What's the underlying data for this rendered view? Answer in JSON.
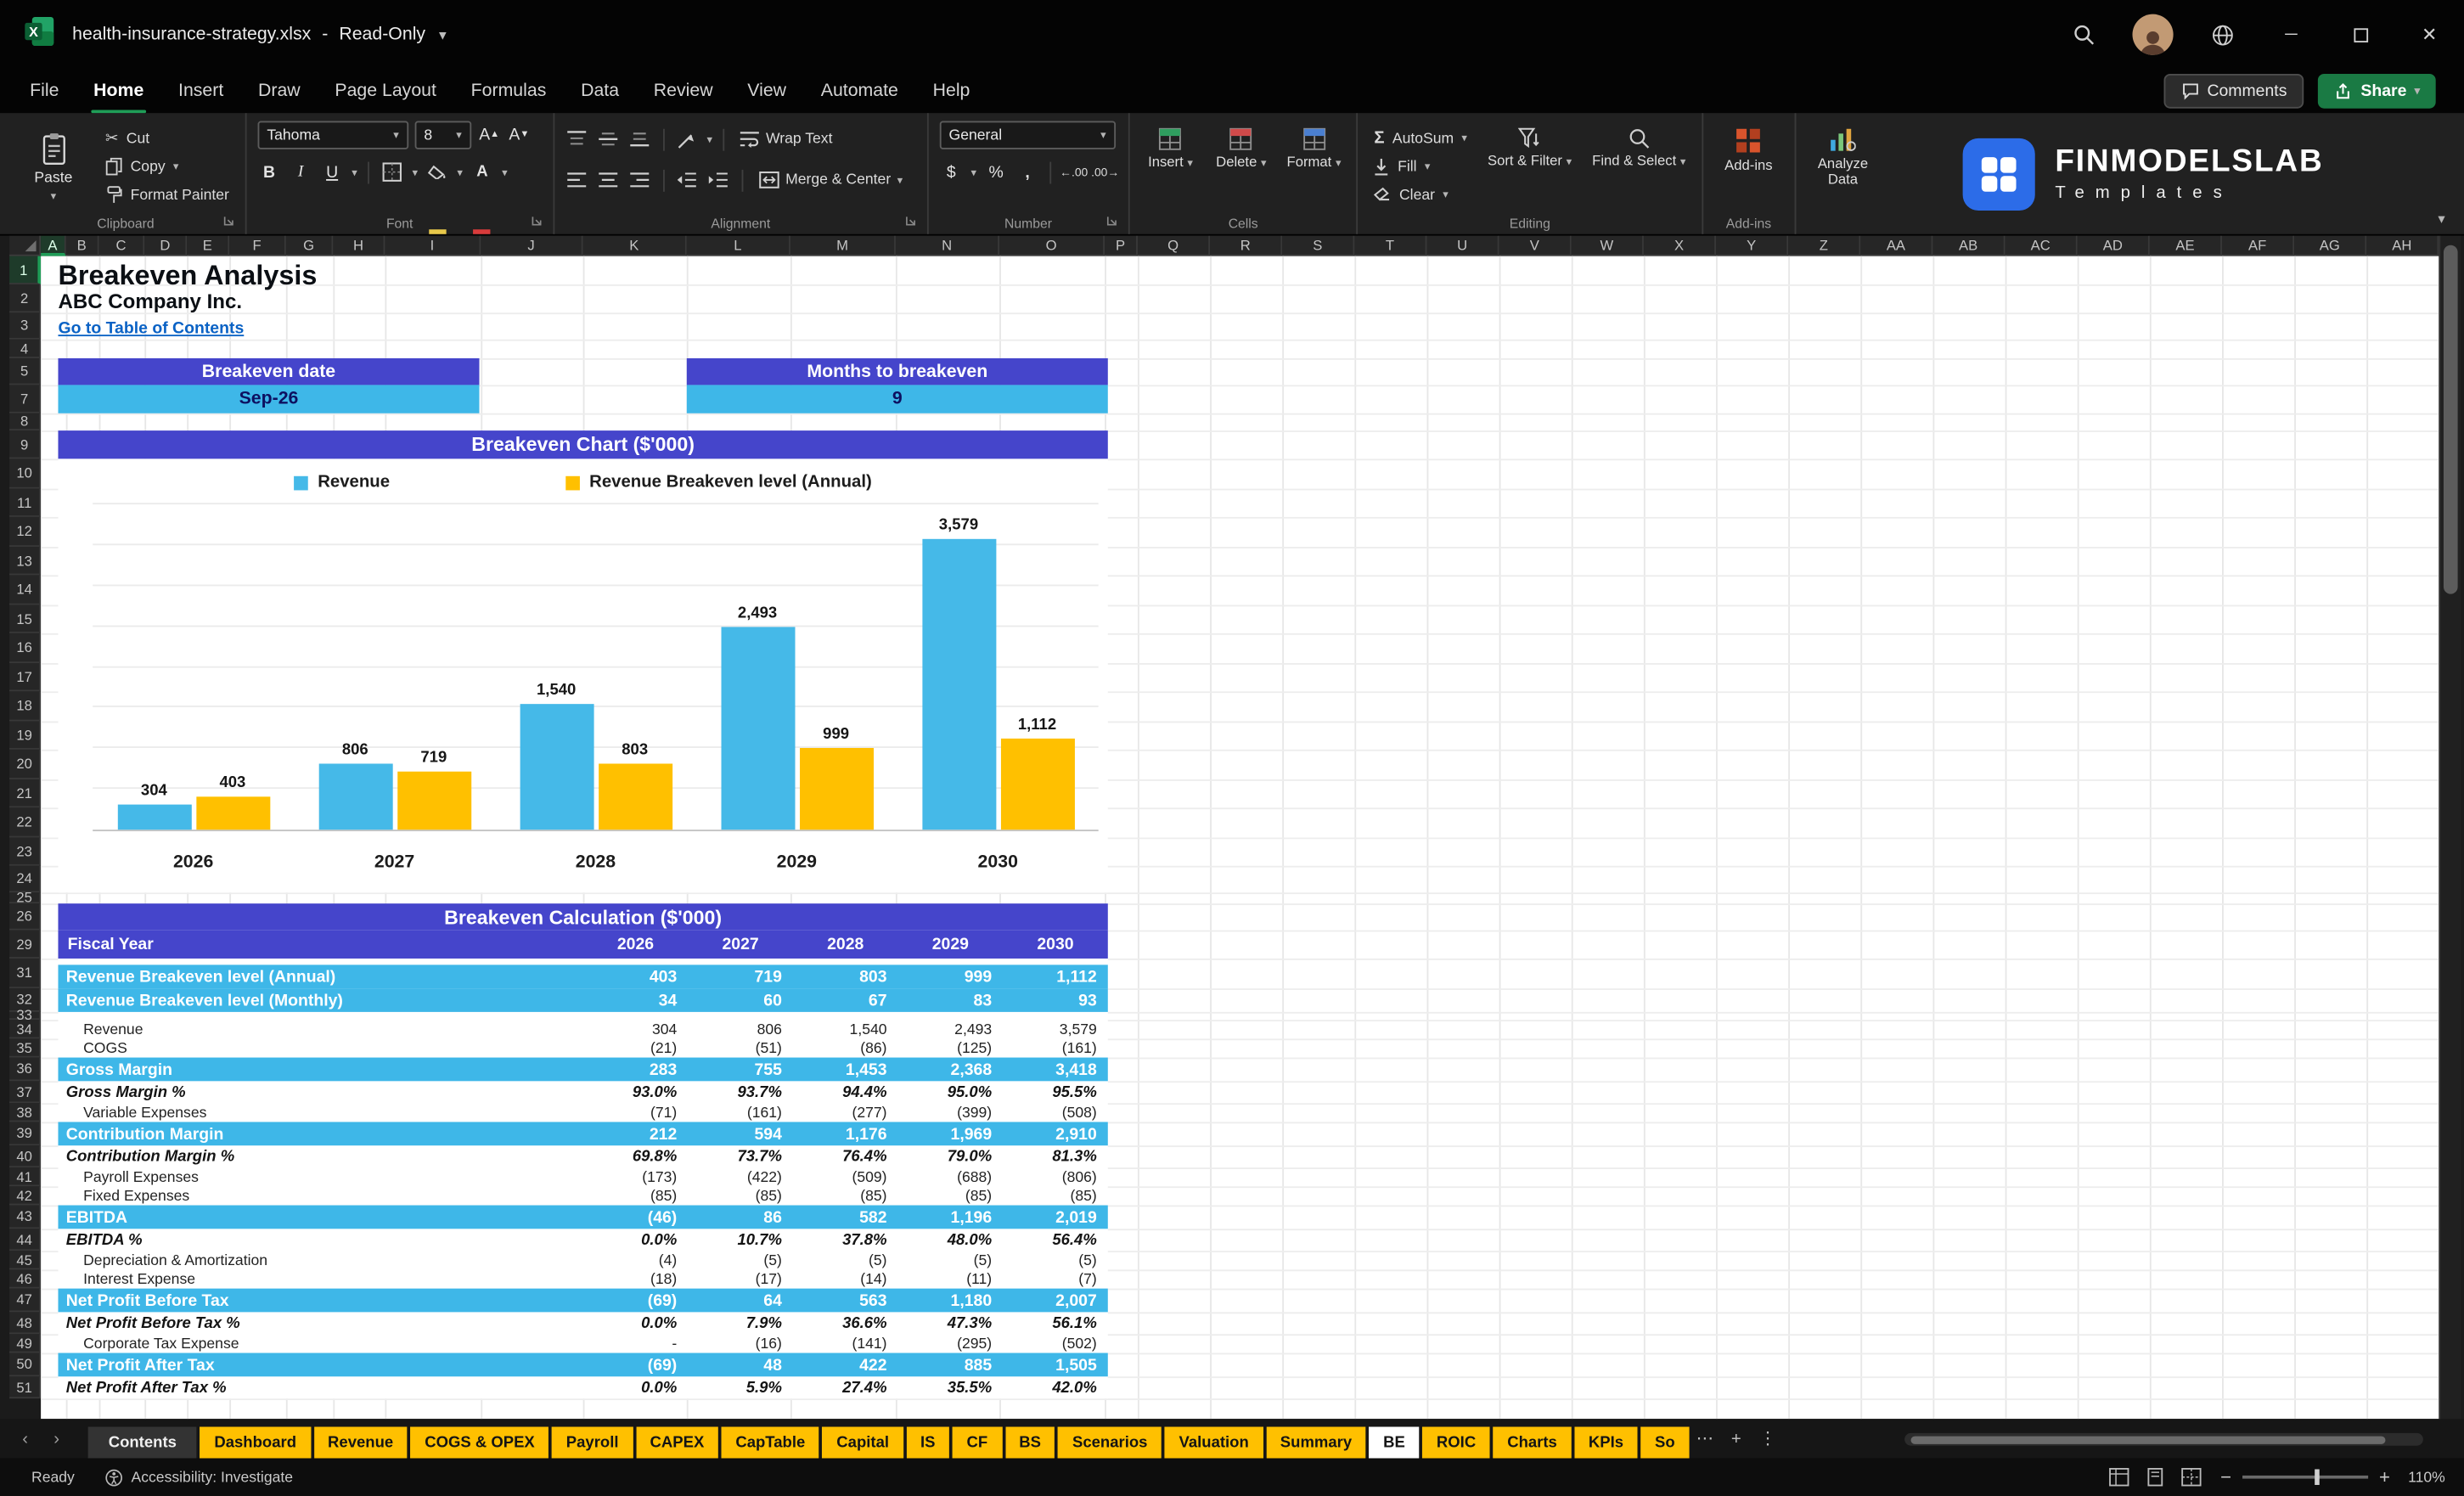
{
  "colors": {
    "banner_purple": "#4545cb",
    "highlight_cyan": "#3eb7e8",
    "gold": "#ffc000",
    "link_blue": "#0a62c5",
    "value_navy": "#0d1060",
    "accent_green": "#1f9d57"
  },
  "titlebar": {
    "file": "health-insurance-strategy.xlsx",
    "separator": "-",
    "mode": "Read-Only"
  },
  "menu": {
    "items": [
      "File",
      "Home",
      "Insert",
      "Draw",
      "Page Layout",
      "Formulas",
      "Data",
      "Review",
      "View",
      "Automate",
      "Help"
    ],
    "active": "Home",
    "comments": "Comments",
    "share": "Share"
  },
  "ribbon": {
    "clipboard": {
      "label": "Clipboard",
      "paste": "Paste",
      "cut": "Cut",
      "copy": "Copy",
      "format_painter": "Format Painter"
    },
    "font": {
      "label": "Font",
      "name": "Tahoma",
      "size": "8"
    },
    "alignment": {
      "label": "Alignment",
      "wrap": "Wrap Text",
      "merge": "Merge & Center"
    },
    "number": {
      "label": "Number",
      "format": "General"
    },
    "cells": {
      "label": "Cells",
      "insert": "Insert",
      "delete": "Delete",
      "format": "Format"
    },
    "editing": {
      "label": "Editing",
      "autosum": "AutoSum",
      "fill": "Fill",
      "clear": "Clear",
      "sort_filter": "Sort & Filter",
      "find_select": "Find & Select"
    },
    "addins_label": "Add-ins",
    "analyze_label": "Analyze Data",
    "logo": {
      "brand": "FINMODELSLAB",
      "sub": "Templates"
    }
  },
  "grid": {
    "cols": [
      "A",
      "B",
      "C",
      "D",
      "E",
      "F",
      "G",
      "H",
      "I",
      "J",
      "K",
      "L",
      "M",
      "N",
      "O",
      "P",
      "Q",
      "R",
      "S",
      "T",
      "U",
      "V",
      "W",
      "X",
      "Y",
      "Z",
      "AA",
      "AB",
      "AC",
      "AD",
      "AE",
      "AF",
      "AG",
      "AH"
    ],
    "rows": [
      "1",
      "2",
      "3",
      "4",
      "5",
      "7",
      "8",
      "9",
      "10",
      "11",
      "12",
      "13",
      "14",
      "15",
      "16",
      "17",
      "18",
      "19",
      "20",
      "21",
      "22",
      "23",
      "24",
      "25",
      "26",
      "29",
      "31",
      "32",
      "33",
      "34",
      "35",
      "36",
      "37",
      "38",
      "39",
      "40",
      "41",
      "42",
      "43",
      "44",
      "45",
      "46",
      "47",
      "48",
      "49",
      "50",
      "51"
    ]
  },
  "sheet": {
    "title": "Breakeven Analysis",
    "company": "ABC Company Inc.",
    "link": "Go to Table of Contents",
    "breakeven_date_label": "Breakeven date",
    "breakeven_date_value": "Sep-26",
    "months_label": "Months to breakeven",
    "months_value": "9",
    "chart_banner": "Breakeven Chart ($'000)",
    "calc_banner": "Breakeven Calculation ($'000)"
  },
  "chart_data": {
    "type": "bar",
    "title": "Breakeven Chart ($'000)",
    "categories": [
      "2026",
      "2027",
      "2028",
      "2029",
      "2030"
    ],
    "series": [
      {
        "name": "Revenue",
        "color": "#45b9e8",
        "values": [
          304,
          806,
          1540,
          2493,
          3579
        ]
      },
      {
        "name": "Revenue Breakeven level (Annual)",
        "color": "#ffc000",
        "values": [
          403,
          719,
          803,
          999,
          1112
        ]
      }
    ],
    "ylim": [
      0,
      4000
    ],
    "gridline_step": 500,
    "grid": true,
    "legend_position": "top",
    "data_labels": true
  },
  "calc_table": {
    "header_label": "Fiscal Year",
    "years": [
      "2026",
      "2027",
      "2028",
      "2029",
      "2030"
    ],
    "rows": [
      {
        "label": "Revenue Breakeven level (Annual)",
        "style": "cyan",
        "values": [
          "403",
          "719",
          "803",
          "999",
          "1,112"
        ]
      },
      {
        "label": "Revenue Breakeven level (Monthly)",
        "style": "cyan",
        "values": [
          "34",
          "60",
          "67",
          "83",
          "93"
        ]
      },
      {
        "label": "Revenue",
        "style": "plain",
        "values": [
          "304",
          "806",
          "1,540",
          "2,493",
          "3,579"
        ]
      },
      {
        "label": "COGS",
        "style": "plain",
        "values": [
          "(21)",
          "(51)",
          "(86)",
          "(125)",
          "(161)"
        ]
      },
      {
        "label": "Gross Margin",
        "style": "cyan",
        "values": [
          "283",
          "755",
          "1,453",
          "2,368",
          "3,418"
        ]
      },
      {
        "label": "Gross Margin %",
        "style": "pct",
        "values": [
          "93.0%",
          "93.7%",
          "94.4%",
          "95.0%",
          "95.5%"
        ]
      },
      {
        "label": "Variable Expenses",
        "style": "plain",
        "values": [
          "(71)",
          "(161)",
          "(277)",
          "(399)",
          "(508)"
        ]
      },
      {
        "label": "Contribution Margin",
        "style": "cyan",
        "values": [
          "212",
          "594",
          "1,176",
          "1,969",
          "2,910"
        ]
      },
      {
        "label": "Contribution Margin %",
        "style": "pct",
        "values": [
          "69.8%",
          "73.7%",
          "76.4%",
          "79.0%",
          "81.3%"
        ]
      },
      {
        "label": "Payroll Expenses",
        "style": "plain",
        "values": [
          "(173)",
          "(422)",
          "(509)",
          "(688)",
          "(806)"
        ]
      },
      {
        "label": "Fixed Expenses",
        "style": "plain",
        "values": [
          "(85)",
          "(85)",
          "(85)",
          "(85)",
          "(85)"
        ]
      },
      {
        "label": "EBITDA",
        "style": "cyan",
        "values": [
          "(46)",
          "86",
          "582",
          "1,196",
          "2,019"
        ]
      },
      {
        "label": "EBITDA %",
        "style": "pct",
        "values": [
          "0.0%",
          "10.7%",
          "37.8%",
          "48.0%",
          "56.4%"
        ]
      },
      {
        "label": "Depreciation & Amortization",
        "style": "plain",
        "values": [
          "(4)",
          "(5)",
          "(5)",
          "(5)",
          "(5)"
        ]
      },
      {
        "label": "Interest Expense",
        "style": "plain",
        "values": [
          "(18)",
          "(17)",
          "(14)",
          "(11)",
          "(7)"
        ]
      },
      {
        "label": "Net Profit Before Tax",
        "style": "cyan",
        "values": [
          "(69)",
          "64",
          "563",
          "1,180",
          "2,007"
        ]
      },
      {
        "label": "Net Profit Before Tax %",
        "style": "pct",
        "values": [
          "0.0%",
          "7.9%",
          "36.6%",
          "47.3%",
          "56.1%"
        ]
      },
      {
        "label": "Corporate Tax Expense",
        "style": "plain",
        "values": [
          "-",
          "(16)",
          "(141)",
          "(295)",
          "(502)"
        ]
      },
      {
        "label": "Net Profit After Tax",
        "style": "cyan",
        "values": [
          "(69)",
          "48",
          "422",
          "885",
          "1,505"
        ]
      },
      {
        "label": "Net Profit After Tax %",
        "style": "pct",
        "values": [
          "0.0%",
          "5.9%",
          "27.4%",
          "35.5%",
          "42.0%"
        ]
      }
    ]
  },
  "sheet_tabs": {
    "items": [
      {
        "label": "Contents",
        "style": "dark"
      },
      {
        "label": "Dashboard",
        "style": "gold"
      },
      {
        "label": "Revenue",
        "style": "gold"
      },
      {
        "label": "COGS & OPEX",
        "style": "gold"
      },
      {
        "label": "Payroll",
        "style": "gold"
      },
      {
        "label": "CAPEX",
        "style": "gold"
      },
      {
        "label": "CapTable",
        "style": "gold"
      },
      {
        "label": "Capital",
        "style": "gold"
      },
      {
        "label": "IS",
        "style": "gold"
      },
      {
        "label": "CF",
        "style": "gold"
      },
      {
        "label": "BS",
        "style": "gold"
      },
      {
        "label": "Scenarios",
        "style": "gold"
      },
      {
        "label": "Valuation",
        "style": "gold"
      },
      {
        "label": "Summary",
        "style": "gold"
      },
      {
        "label": "BE",
        "style": "active"
      },
      {
        "label": "ROIC",
        "style": "gold"
      },
      {
        "label": "Charts",
        "style": "gold"
      },
      {
        "label": "KPIs",
        "style": "gold"
      },
      {
        "label": "So",
        "style": "gold"
      }
    ]
  },
  "status": {
    "ready": "Ready",
    "accessibility": "Accessibility: Investigate",
    "zoom": "110%"
  }
}
